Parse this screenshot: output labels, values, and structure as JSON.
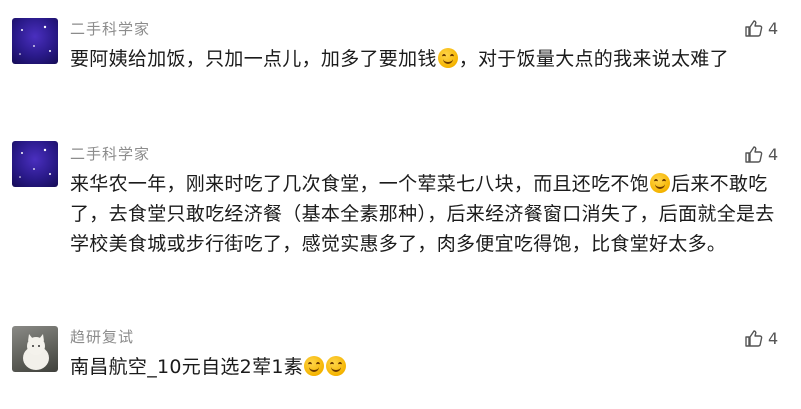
{
  "comments": [
    {
      "username": "二手科学家",
      "like_count": "4",
      "text_parts": [
        "要阿姨给加饭，只加一点儿，加多了要加钱",
        "，对于饭量大点的我来说太难了"
      ],
      "emoji_icon": "sweat-smile-emoji-icon"
    },
    {
      "username": "二手科学家",
      "like_count": "4",
      "text_parts": [
        "来华农一年，刚来时吃了几次食堂，一个荤菜七八块，而且还吃不饱",
        "后来不敢吃了，去食堂只敢吃经济餐（基本全素那种），后来经济餐窗口消失了，后面就全是去学校美食城或步行街吃了，感觉实惠多了，肉多便宜吃得饱，比食堂好太多。"
      ],
      "emoji_icon": "sweat-smile-emoji-icon"
    },
    {
      "username": "趋研复试",
      "like_count": "4",
      "text_parts": [
        "南昌航空_10元自选2荤1素"
      ],
      "emoji_icon": "grin-emoji-icon"
    }
  ]
}
